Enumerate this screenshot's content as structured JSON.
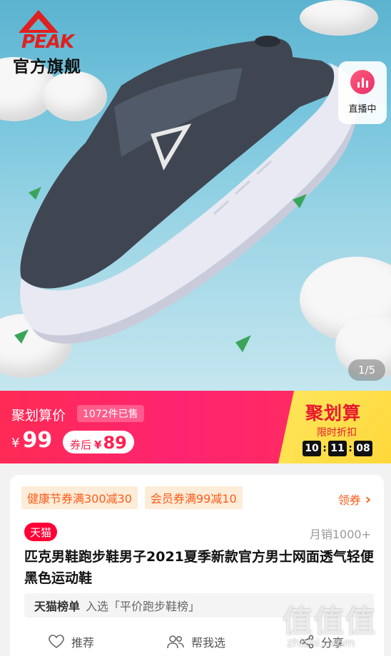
{
  "brand": {
    "logo_text": "PEAK",
    "store_name": "官方旗舰"
  },
  "live": {
    "label": "直播中",
    "icon": "live-bars-icon"
  },
  "gallery": {
    "counter": "1/5"
  },
  "promo": {
    "label": "聚划算价",
    "sold": "1072件已售",
    "price_currency": "¥",
    "price": "99",
    "coupon_label": "券后",
    "coupon_currency": "¥",
    "coupon_price": "89",
    "campaign_name": "聚划算",
    "campaign_sub": "限时折扣",
    "countdown": {
      "h": "10",
      "m": "11",
      "s": "08",
      "sep": ":"
    }
  },
  "coupons": [
    {
      "label": "健康节券满300减30"
    },
    {
      "label": "会员券满99减10"
    }
  ],
  "get_coupon": {
    "label": "领券",
    "icon": "chevron-right-icon"
  },
  "product": {
    "store_badge": "天猫",
    "monthly_sales": "月销1000+",
    "title": "匹克男鞋跑步鞋男子2021夏季新款官方男士网面透气轻便黑色运动鞋"
  },
  "ranking": {
    "name": "天猫榜单",
    "text": "入选「平价跑步鞋榜」"
  },
  "actions": [
    {
      "label": "推荐",
      "icon": "heart-icon"
    },
    {
      "label": "帮我选",
      "icon": "people-icon"
    },
    {
      "label": "分享",
      "icon": "share-icon"
    }
  ],
  "watermark": {
    "text": "值值值",
    "url": "zhizhi...com"
  },
  "colors": {
    "promo_red": "#ff2a55",
    "campaign_yellow": "#ffe45a",
    "coupon_orange": "#ff5b1a",
    "tmall_red": "#ff0036"
  }
}
